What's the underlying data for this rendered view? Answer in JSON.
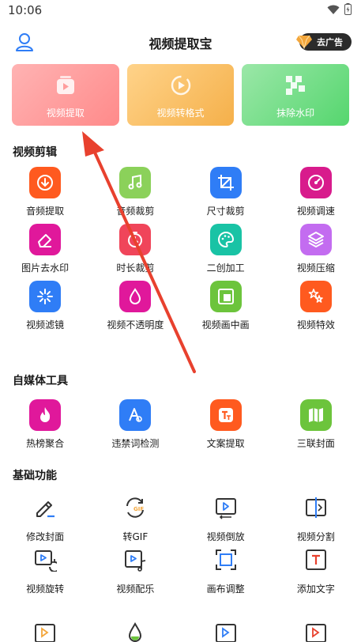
{
  "status": {
    "time": "10:06"
  },
  "header": {
    "title": "视频提取宝",
    "ad_label": "去广告"
  },
  "feature_cards": [
    {
      "label": "视频提取",
      "icon": "video-box-icon",
      "color": "#ff9d9d"
    },
    {
      "label": "视频转格式",
      "icon": "convert-icon",
      "color": "#f7bf62"
    },
    {
      "label": "抹除水印",
      "icon": "mosaic-icon",
      "color": "#6fdc84"
    }
  ],
  "sections": {
    "edit": {
      "title": "视频剪辑",
      "items": [
        {
          "label": "音频提取",
          "icon": "download-circle-icon",
          "color": "#ff5a1f"
        },
        {
          "label": "音频裁剪",
          "icon": "music-note-icon",
          "color": "#8bd15a"
        },
        {
          "label": "尺寸裁剪",
          "icon": "crop-icon",
          "color": "#2f7df6"
        },
        {
          "label": "视频调速",
          "icon": "speed-icon",
          "color": "#d81b8c"
        },
        {
          "label": "图片去水印",
          "icon": "eraser-icon",
          "color": "#e0189b"
        },
        {
          "label": "时长裁剪",
          "icon": "timer-icon",
          "color": "#f0455a"
        },
        {
          "label": "二创加工",
          "icon": "palette-icon",
          "color": "#19c3a5"
        },
        {
          "label": "视频压缩",
          "icon": "layers-icon",
          "color": "#c36cf0"
        },
        {
          "label": "视频滤镜",
          "icon": "sparkle-icon",
          "color": "#2f7df6"
        },
        {
          "label": "视频不透明度",
          "icon": "drop-icon",
          "color": "#e0189b"
        },
        {
          "label": "视频画中画",
          "icon": "pip-icon",
          "color": "#6cc43c"
        },
        {
          "label": "视频特效",
          "icon": "stars-icon",
          "color": "#ff5a1f"
        }
      ]
    },
    "media": {
      "title": "自媒体工具",
      "items": [
        {
          "label": "热榜聚合",
          "icon": "flame-icon",
          "color": "#e0189b"
        },
        {
          "label": "违禁词检测",
          "icon": "detect-icon",
          "color": "#2f7df6"
        },
        {
          "label": "文案提取",
          "icon": "text-t-icon",
          "color": "#ff5a1f"
        },
        {
          "label": "三联封面",
          "icon": "map-fold-icon",
          "color": "#6cc43c"
        }
      ]
    },
    "basic": {
      "title": "基础功能",
      "items": [
        {
          "label": "修改封面",
          "icon": "pen-icon"
        },
        {
          "label": "转GIF",
          "icon": "gif-icon",
          "badge": "GIF"
        },
        {
          "label": "视频倒放",
          "icon": "reverse-play-icon"
        },
        {
          "label": "视频分割",
          "icon": "split-icon"
        },
        {
          "label": "视频旋转",
          "icon": "rotate-icon"
        },
        {
          "label": "视频配乐",
          "icon": "music-video-icon"
        },
        {
          "label": "画布调整",
          "icon": "canvas-icon"
        },
        {
          "label": "添加文字",
          "icon": "add-text-icon"
        }
      ]
    }
  },
  "colors": {
    "accent": "#e8412e",
    "icon_line": "#333333",
    "icon_accent": "#2f7df6"
  }
}
